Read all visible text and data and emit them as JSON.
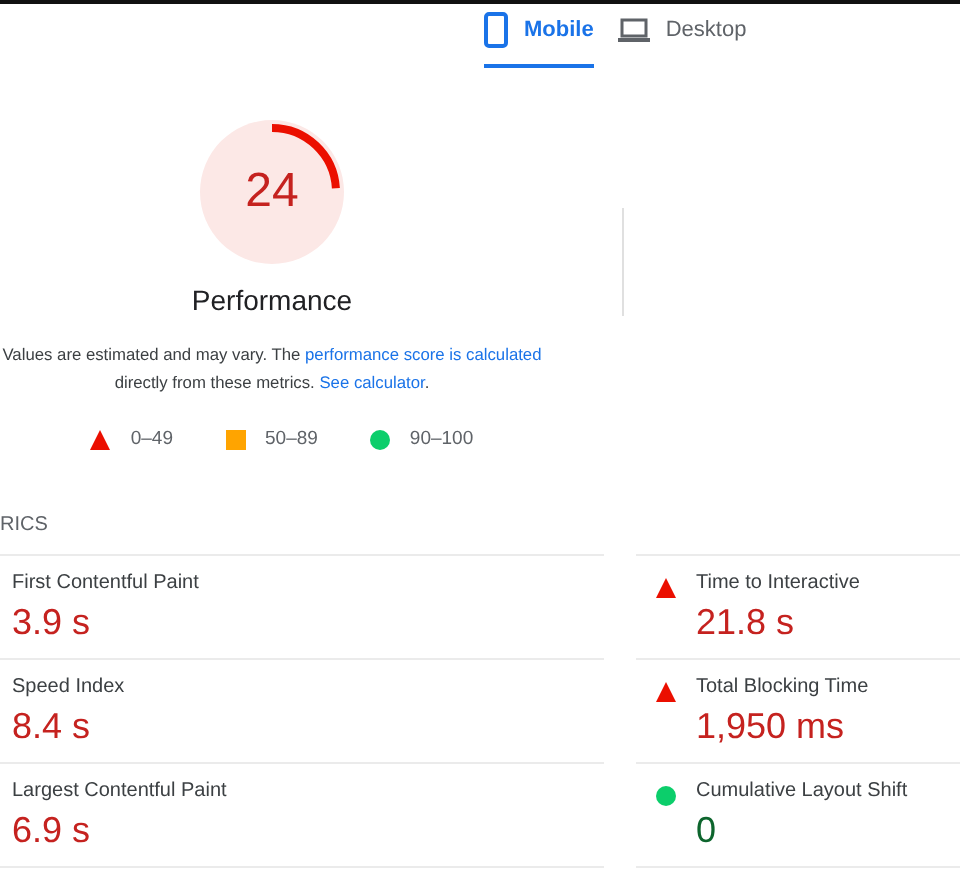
{
  "tabs": [
    {
      "label": "Mobile",
      "selected": true
    },
    {
      "label": "Desktop",
      "selected": false
    }
  ],
  "gauge": {
    "score": "24",
    "title": "Performance"
  },
  "note": {
    "text": "Values are estimated and may vary. The ",
    "link": "performance score is calculated",
    "text_2": " directly from these metrics. ",
    "link_2": "See calculator",
    "end": "."
  },
  "legend": [
    {
      "kind": "fail",
      "label": "0–49"
    },
    {
      "kind": "average",
      "label": "50–89"
    },
    {
      "kind": "pass",
      "label": "90–100"
    }
  ],
  "metrics_heading": "RICS",
  "metrics_left": [
    {
      "name": "First Contentful Paint",
      "value": "3.9 s",
      "kind": "fail"
    },
    {
      "name": "Speed Index",
      "value": "8.4 s",
      "kind": "fail"
    },
    {
      "name": "Largest Contentful Paint",
      "value": "6.9 s",
      "kind": "fail"
    }
  ],
  "metrics_right": [
    {
      "name": "Time to Interactive",
      "value": "21.8 s",
      "kind": "fail"
    },
    {
      "name": "Total Blocking Time",
      "value": "1,950 ms",
      "kind": "fail"
    },
    {
      "name": "Cumulative Layout Shift",
      "value": "0",
      "kind": "pass"
    }
  ]
}
